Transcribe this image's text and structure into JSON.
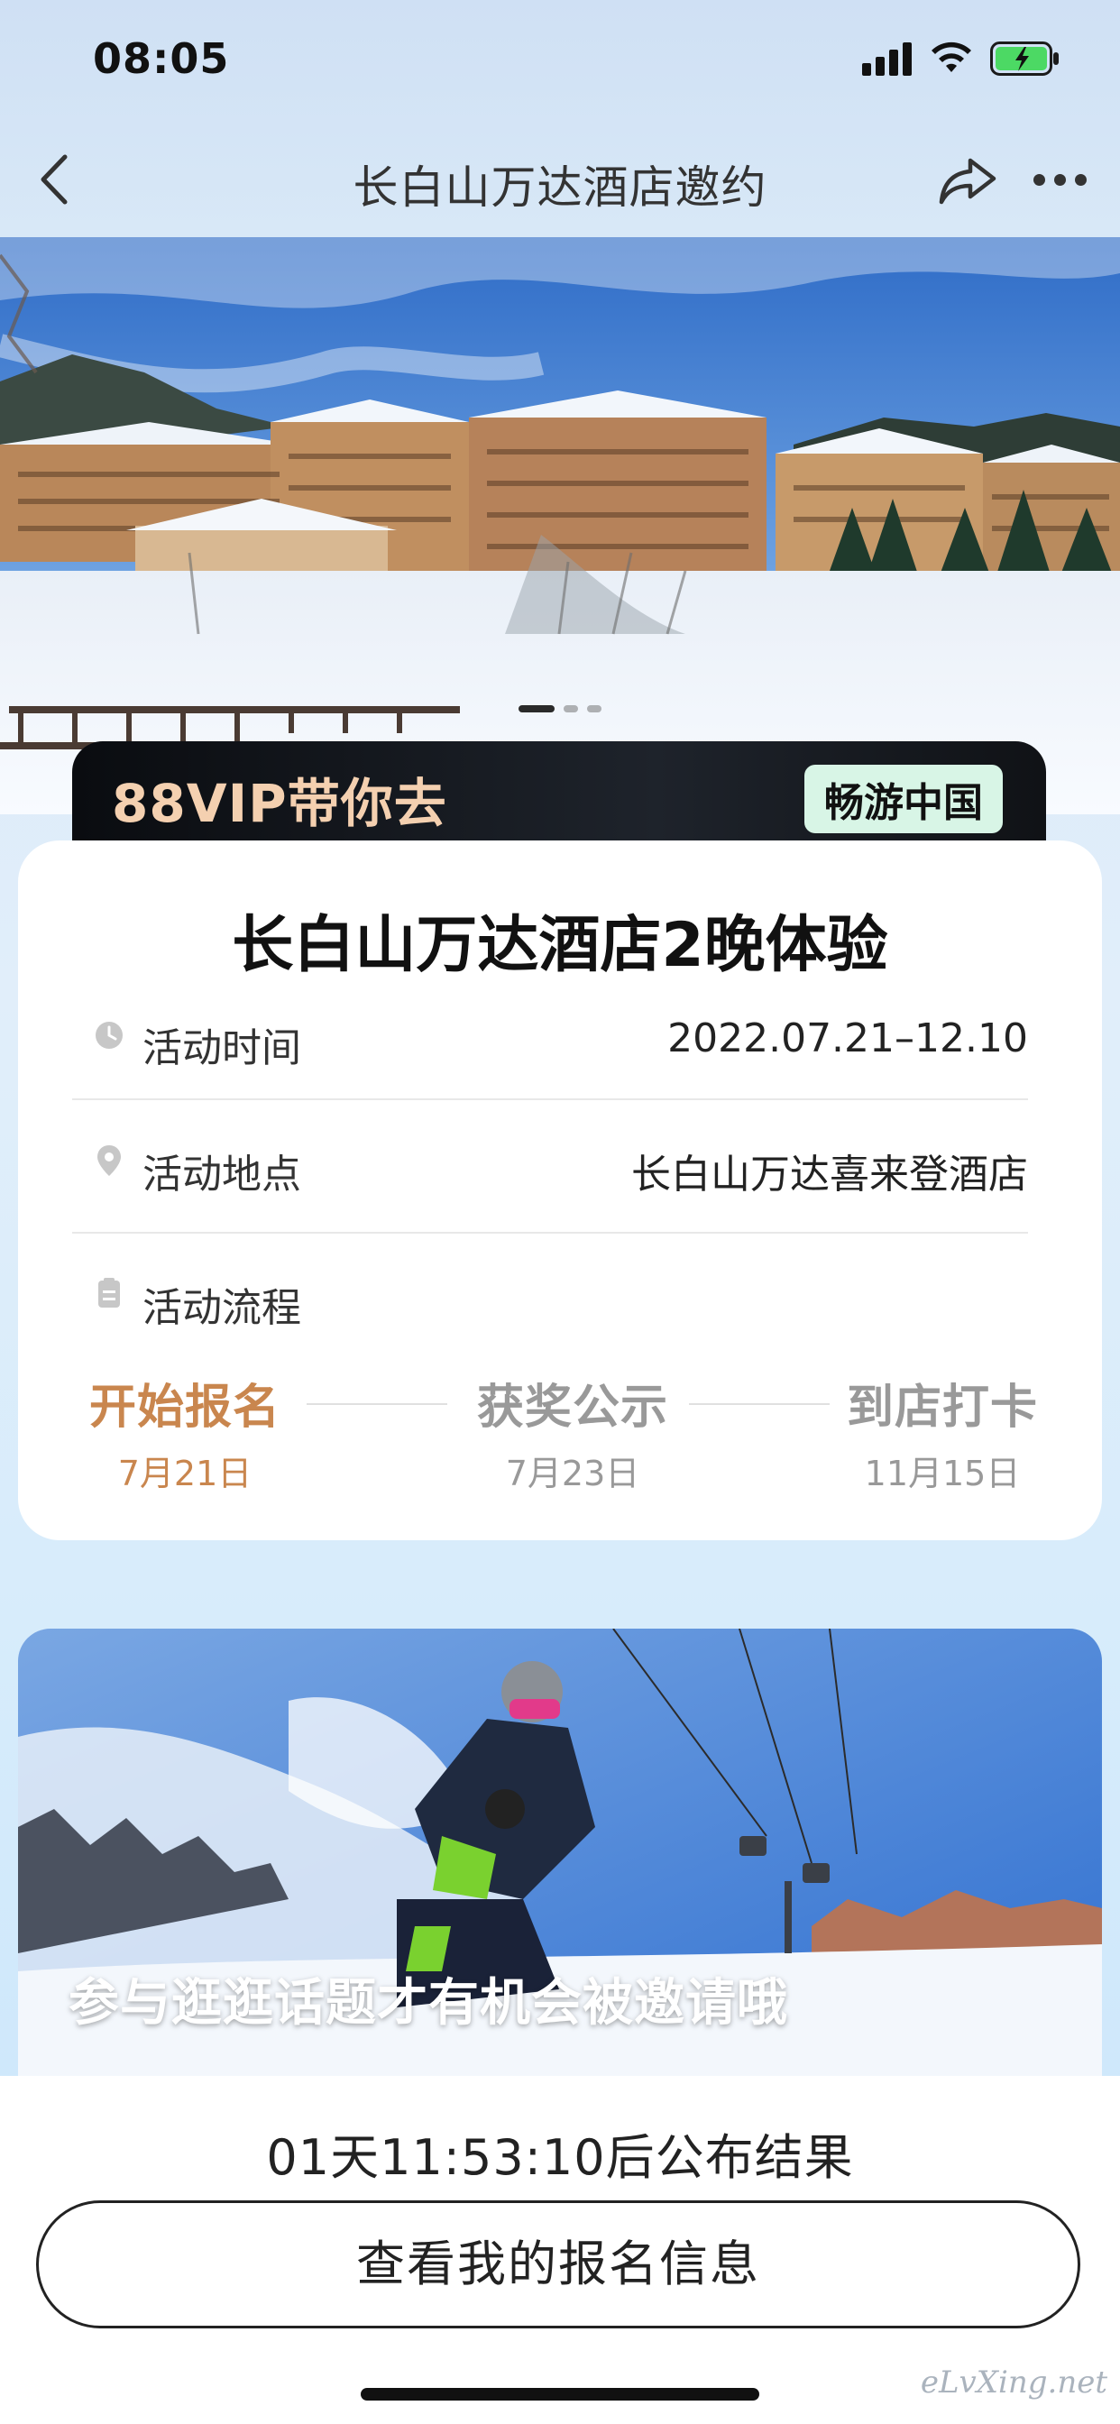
{
  "status_bar": {
    "time": "08:05"
  },
  "nav": {
    "title": "长白山万达酒店邀约",
    "back_icon": "chevron-left-icon",
    "share_icon": "share-icon",
    "more_icon": "more-dots-icon"
  },
  "hero": {
    "dots": 3,
    "active_dot": 0
  },
  "vip_banner": {
    "text": "88VIP带你去",
    "tag": "畅游中国"
  },
  "card": {
    "title": "长白山万达酒店2晚体验",
    "time_label": "活动时间",
    "time_value": "2022.07.21–12.10",
    "location_label": "活动地点",
    "location_value": "长白山万达喜来登酒店",
    "process_label": "活动流程",
    "steps": [
      {
        "name": "开始报名",
        "date": "7月21日",
        "active": true
      },
      {
        "name": "获奖公示",
        "date": "7月23日",
        "active": false
      },
      {
        "name": "到店打卡",
        "date": "11月15日",
        "active": false
      }
    ]
  },
  "promo": {
    "caption": "参与逛逛话题才有机会被邀请哦"
  },
  "bottom": {
    "countdown": "01天11:53:10后公布结果",
    "button_label": "查看我的报名信息"
  },
  "watermark": "eLvXing.net",
  "colors": {
    "accent_orange": "#c9864e",
    "inactive_gray": "#999999",
    "vip_gold": "#f4d0b0",
    "vip_tag_bg": "#d8f5e6"
  }
}
